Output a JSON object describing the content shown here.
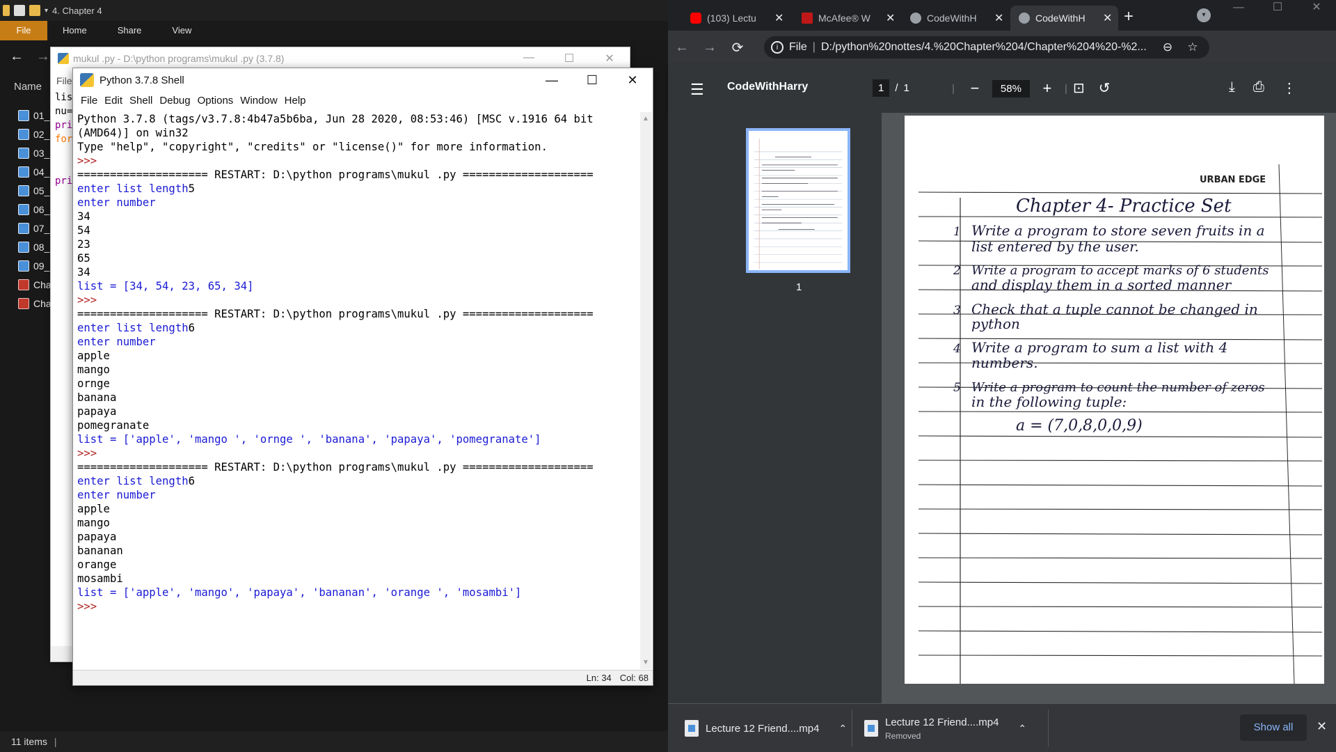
{
  "explorer": {
    "window_title": "4. Chapter 4",
    "ribbon_tabs": [
      "File",
      "Home",
      "Share",
      "View"
    ],
    "name_header": "Name",
    "files": [
      "01_",
      "02_",
      "03_",
      "04_",
      "05_",
      "06_",
      "07_",
      "08_",
      "09_",
      "Cha",
      "Cha"
    ],
    "status": "11 items"
  },
  "editor": {
    "title": "mukul .py - D:\\python programs\\mukul .py (3.7.8)",
    "menu_first": "File",
    "code_fragments": [
      "lis",
      "nu=",
      "pri",
      "for",
      "",
      "",
      "pri"
    ]
  },
  "shell": {
    "title": "Python 3.7.8 Shell",
    "menu": [
      "File",
      "Edit",
      "Shell",
      "Debug",
      "Options",
      "Window",
      "Help"
    ],
    "lines": [
      {
        "t": "plain",
        "s": "Python 3.7.8 (tags/v3.7.8:4b47a5b6ba, Jun 28 2020, 08:53:46) [MSC v.1916 64 bit"
      },
      {
        "t": "plain",
        "s": "(AMD64)] on win32"
      },
      {
        "t": "plain",
        "s": "Type \"help\", \"copyright\", \"credits\" or \"license()\" for more information."
      },
      {
        "t": "prompt",
        "s": ">>> "
      },
      {
        "t": "plain",
        "s": "==================== RESTART: D:\\python programs\\mukul .py ===================="
      },
      {
        "t": "ask",
        "s": "enter list length",
        "v": "5"
      },
      {
        "t": "out",
        "s": "enter number"
      },
      {
        "t": "plain",
        "s": "34"
      },
      {
        "t": "plain",
        "s": "54"
      },
      {
        "t": "plain",
        "s": "23"
      },
      {
        "t": "plain",
        "s": "65"
      },
      {
        "t": "plain",
        "s": "34"
      },
      {
        "t": "out",
        "s": "list = [34, 54, 23, 65, 34]"
      },
      {
        "t": "prompt",
        "s": ">>> "
      },
      {
        "t": "plain",
        "s": "==================== RESTART: D:\\python programs\\mukul .py ===================="
      },
      {
        "t": "ask",
        "s": "enter list length",
        "v": "6"
      },
      {
        "t": "out",
        "s": "enter number"
      },
      {
        "t": "plain",
        "s": "apple"
      },
      {
        "t": "plain",
        "s": "mango"
      },
      {
        "t": "plain",
        "s": "ornge"
      },
      {
        "t": "plain",
        "s": "banana"
      },
      {
        "t": "plain",
        "s": "papaya"
      },
      {
        "t": "plain",
        "s": "pomegranate"
      },
      {
        "t": "out",
        "s": "list = ['apple', 'mango ', 'ornge ', 'banana', 'papaya', 'pomegranate']"
      },
      {
        "t": "prompt",
        "s": ">>> "
      },
      {
        "t": "plain",
        "s": "==================== RESTART: D:\\python programs\\mukul .py ===================="
      },
      {
        "t": "ask",
        "s": "enter list length",
        "v": "6"
      },
      {
        "t": "out",
        "s": "enter number"
      },
      {
        "t": "plain",
        "s": "apple"
      },
      {
        "t": "plain",
        "s": "mango"
      },
      {
        "t": "plain",
        "s": "papaya"
      },
      {
        "t": "plain",
        "s": "bananan"
      },
      {
        "t": "plain",
        "s": "orange"
      },
      {
        "t": "plain",
        "s": "mosambi"
      },
      {
        "t": "out",
        "s": "list = ['apple', 'mango', 'papaya', 'bananan', 'orange ', 'mosambi']"
      },
      {
        "t": "prompt",
        "s": ">>> "
      }
    ],
    "status_ln": "Ln: 34",
    "status_col": "Col: 68"
  },
  "chrome": {
    "tabs": [
      {
        "label": "(103) Lectu",
        "icon": "youtube-icon"
      },
      {
        "label": "McAfee® W",
        "icon": "mcafee-icon"
      },
      {
        "label": "CodeWithH",
        "icon": "globe-icon"
      },
      {
        "label": "CodeWithH",
        "icon": "globe-icon",
        "active": true
      }
    ],
    "url_scheme": "File",
    "url": "D:/python%20nottes/4.%20Chapter%204/Chapter%204%20-%2...",
    "pdf": {
      "title": "CodeWithHarry",
      "page_current": "1",
      "page_total": "1",
      "zoom": "58%",
      "thumb_number": "1"
    },
    "notes": {
      "heading": "Chapter 4- Practice Set",
      "brand": "URBAN EDGE",
      "items": [
        {
          "n": "1",
          "l1": "Write a program to store seven fruits in a",
          "l2": "list entered by the user."
        },
        {
          "n": "2",
          "l1": "Write a program to accept marks of 6 students",
          "l2": "and display them in a sorted manner"
        },
        {
          "n": "3",
          "l1": "Check that a tuple cannot be changed in",
          "l2": "python"
        },
        {
          "n": "4",
          "l1": "Write a program to sum a list with 4",
          "l2": "numbers."
        },
        {
          "n": "5",
          "l1": "Write a program to count the number of zeros",
          "l2": "in the following tuple:"
        }
      ],
      "tuple_line": "a = (7,0,8,0,0,9)"
    },
    "downloads": [
      {
        "name": "Lecture 12 Friend....mp4",
        "sub": ""
      },
      {
        "name": "Lecture 12 Friend....mp4",
        "sub": "Removed"
      }
    ],
    "show_all": "Show all"
  }
}
